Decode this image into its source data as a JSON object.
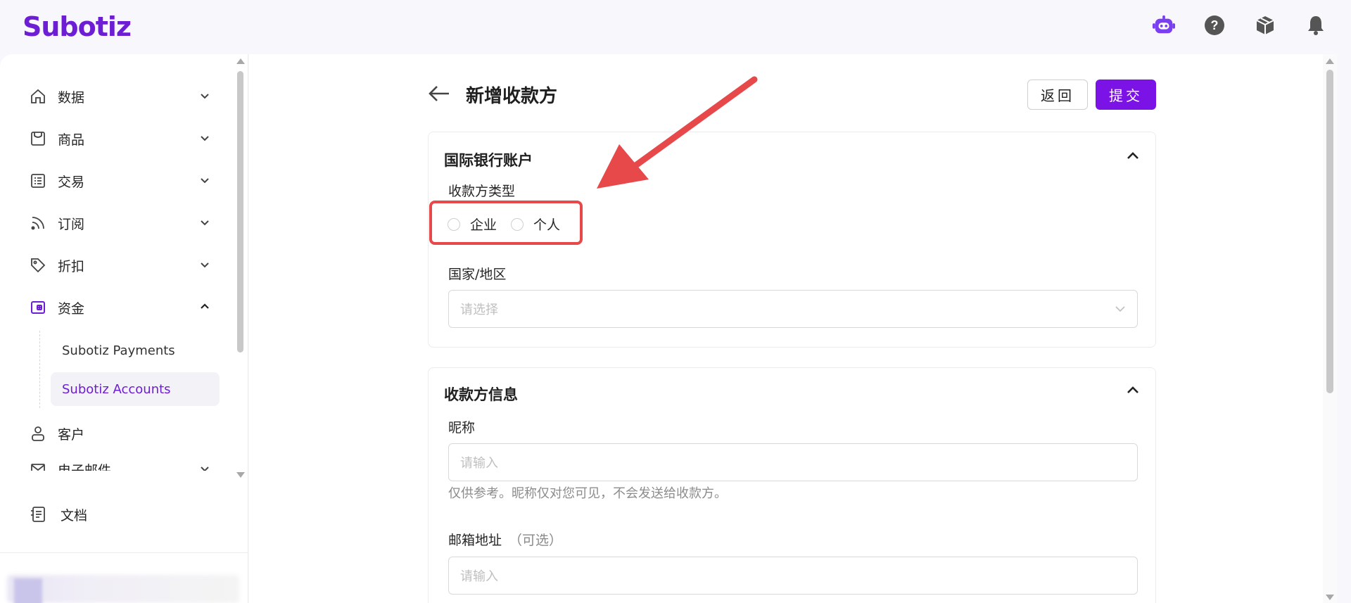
{
  "header": {
    "logo": "Subotiz",
    "icons": [
      "bot-icon",
      "help-icon",
      "package-icon",
      "bell-icon"
    ]
  },
  "sidebar": {
    "items": [
      {
        "label": "数据",
        "icon": "home-icon",
        "expanded": false
      },
      {
        "label": "商品",
        "icon": "store-icon",
        "expanded": false
      },
      {
        "label": "交易",
        "icon": "list-icon",
        "expanded": false
      },
      {
        "label": "订阅",
        "icon": "rss-icon",
        "expanded": false
      },
      {
        "label": "折扣",
        "icon": "tag-icon",
        "expanded": false
      },
      {
        "label": "资金",
        "icon": "wallet-icon",
        "expanded": true
      },
      {
        "label": "客户",
        "icon": "user-icon"
      },
      {
        "label": "电子邮件",
        "icon": "mail-icon",
        "expanded": false
      },
      {
        "label": "文档",
        "icon": "doc-icon"
      }
    ],
    "sub_items": [
      {
        "label": "Subotiz Payments",
        "active": false
      },
      {
        "label": "Subotiz Accounts",
        "active": true
      }
    ]
  },
  "page": {
    "title": "新增收款方",
    "back_button": "返回",
    "submit_button": "提交"
  },
  "bank_card": {
    "title": "国际银行账户",
    "payee_type_label": "收款方类型",
    "payee_type_options": [
      "企业",
      "个人"
    ],
    "country_label": "国家/地区",
    "country_placeholder": "请选择"
  },
  "payee_card": {
    "title": "收款方信息",
    "nickname_label": "昵称",
    "nickname_placeholder": "请输入",
    "nickname_hint": "仅供参考。昵称仅对您可见，不会发送给收款方。",
    "email_label": "邮箱地址",
    "email_optional": "（可选）",
    "email_placeholder": "请输入"
  },
  "colors": {
    "brand": "#6d1ed4",
    "primary_button": "#7b12e6",
    "annotation": "#e7484a"
  }
}
